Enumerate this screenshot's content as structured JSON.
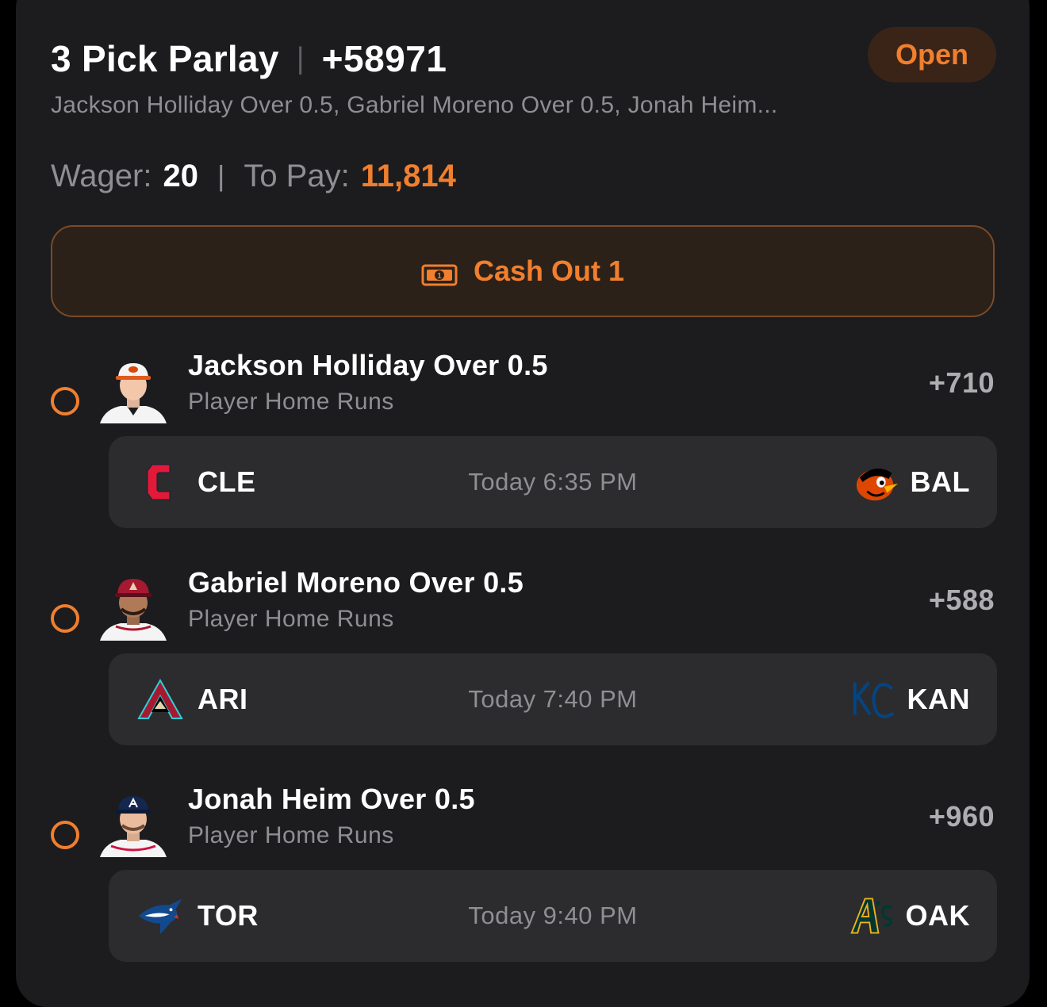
{
  "bet": {
    "title": "3 Pick Parlay",
    "separator": "|",
    "odds": "+58971",
    "status": "Open",
    "summary": "Jackson Holliday Over 0.5, Gabriel Moreno Over 0.5, Jonah Heim...",
    "wager_label": "Wager:",
    "wager_value": "20",
    "pay_label": "To Pay:",
    "pay_value": "11,814",
    "cashout_label": "Cash Out 1"
  },
  "picks": [
    {
      "selection": "Jackson Holliday Over 0.5",
      "market": "Player Home Runs",
      "odds": "+710",
      "away": "CLE",
      "home": "BAL",
      "time": "Today 6:35 PM",
      "away_logo": "guardians-logo",
      "home_logo": "orioles-logo",
      "cap_color": "#f4f4f4"
    },
    {
      "selection": "Gabriel Moreno Over 0.5",
      "market": "Player Home Runs",
      "odds": "+588",
      "away": "ARI",
      "home": "KAN",
      "time": "Today 7:40 PM",
      "away_logo": "diamondbacks-logo",
      "home_logo": "royals-logo",
      "cap_color": "#a71930"
    },
    {
      "selection": "Jonah Heim Over 0.5",
      "market": "Player Home Runs",
      "odds": "+960",
      "away": "TOR",
      "home": "OAK",
      "time": "Today 9:40 PM",
      "away_logo": "blue-jays-logo",
      "home_logo": "athletics-logo",
      "cap_color": "#13274f"
    }
  ],
  "colors": {
    "accent": "#f07f2e",
    "card_bg": "#1c1c1e",
    "game_bg": "#2c2c2e",
    "muted_text": "#8e8e93"
  }
}
